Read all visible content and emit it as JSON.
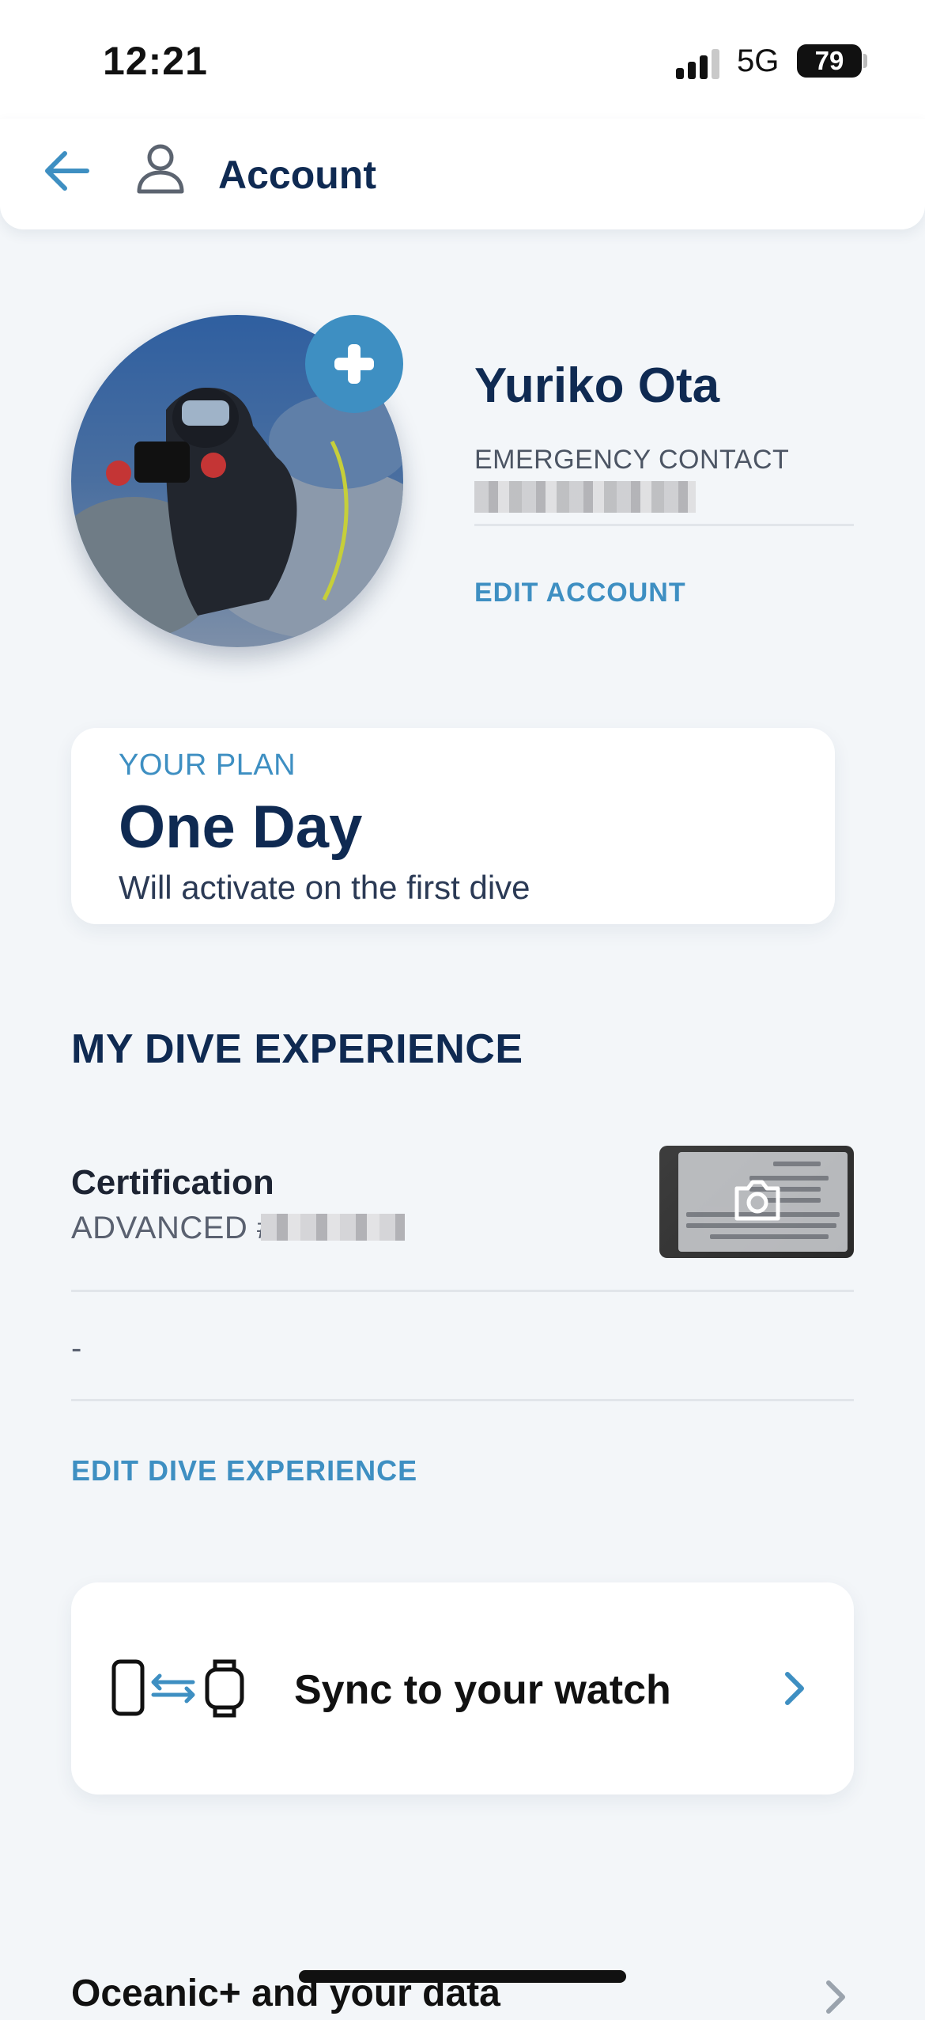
{
  "status_bar": {
    "time": "12:21",
    "network": "5G",
    "battery": "79"
  },
  "header": {
    "back_icon": "back-arrow-icon",
    "account_icon": "person-icon",
    "title": "Account"
  },
  "profile": {
    "name": "Yuriko Ota",
    "emergency_label": "EMERGENCY CONTACT",
    "edit_account": "EDIT ACCOUNT",
    "add_icon": "plus-icon"
  },
  "plan": {
    "label": "YOUR PLAN",
    "name": "One Day",
    "description": "Will activate on the first dive"
  },
  "dive_experience": {
    "title": "MY DIVE EXPERIENCE",
    "certification_label": "Certification",
    "certification_value": "ADVANCED #",
    "secondary_value": "-",
    "edit_label": "EDIT DIVE EXPERIENCE",
    "camera_icon": "camera-icon"
  },
  "sync": {
    "label": "Sync to your watch",
    "icon": "phone-watch-sync-icon",
    "chevron": "chevron-right-icon"
  },
  "next_row": {
    "label": "Oceanic+ and your data"
  },
  "colors": {
    "accent": "#3e8fc2",
    "navy": "#0f2a52",
    "background": "#f3f6f9"
  }
}
